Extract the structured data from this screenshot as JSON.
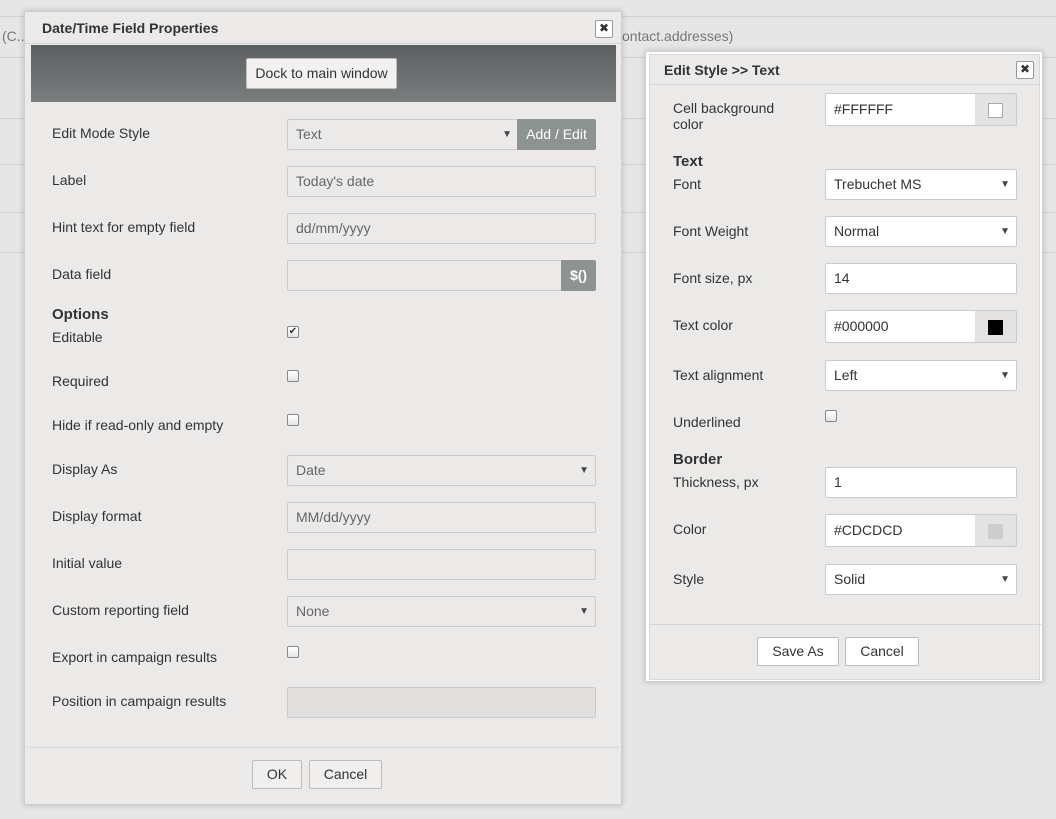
{
  "background": {
    "left_fragment": "(C...",
    "right_fragment": "ontact.addresses)"
  },
  "main_dialog": {
    "title": "Date/Time Field Properties",
    "dock_button": "Dock to main window",
    "edit_mode_style": {
      "label": "Edit Mode Style",
      "value": "Text",
      "button": "Add / Edit"
    },
    "label_field": {
      "label": "Label",
      "value": "Today's date"
    },
    "hint_field": {
      "label": "Hint text for empty field",
      "value": "dd/mm/yyyy"
    },
    "data_field": {
      "label": "Data field",
      "value": "",
      "button": "$()"
    },
    "options_heading": "Options",
    "editable": {
      "label": "Editable",
      "checked": true
    },
    "required": {
      "label": "Required",
      "checked": false
    },
    "hide_if_empty": {
      "label": "Hide if read-only and empty",
      "checked": false
    },
    "display_as": {
      "label": "Display As",
      "value": "Date"
    },
    "display_format": {
      "label": "Display format",
      "value": "MM/dd/yyyy"
    },
    "initial_value": {
      "label": "Initial value",
      "value": ""
    },
    "custom_reporting": {
      "label": "Custom reporting field",
      "value": "None"
    },
    "export_results": {
      "label": "Export in campaign results",
      "checked": false
    },
    "position_results": {
      "label": "Position in campaign results",
      "value": ""
    },
    "ok_button": "OK",
    "cancel_button": "Cancel"
  },
  "style_dialog": {
    "title": "Edit Style >> Text",
    "cell_bg": {
      "label": "Cell background color",
      "value": "#FFFFFF",
      "swatch": "#FFFFFF"
    },
    "text_heading": "Text",
    "font": {
      "label": "Font",
      "value": "Trebuchet MS"
    },
    "font_weight": {
      "label": "Font Weight",
      "value": "Normal"
    },
    "font_size": {
      "label": "Font size, px",
      "value": "14"
    },
    "text_color": {
      "label": "Text color",
      "value": "#000000",
      "swatch": "#000000"
    },
    "text_alignment": {
      "label": "Text alignment",
      "value": "Left"
    },
    "underlined": {
      "label": "Underlined",
      "checked": false
    },
    "border_heading": "Border",
    "thickness": {
      "label": "Thickness, px",
      "value": "1"
    },
    "border_color": {
      "label": "Color",
      "value": "#CDCDCD",
      "swatch": "#CDCDCD"
    },
    "border_style": {
      "label": "Style",
      "value": "Solid"
    },
    "save_as_button": "Save As",
    "cancel_button": "Cancel"
  },
  "icons": {
    "close": "close-icon",
    "dropdown": "chevron-down-icon",
    "check": "checkmark-icon"
  }
}
